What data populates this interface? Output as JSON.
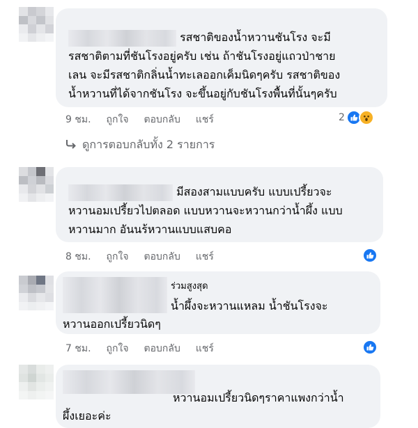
{
  "comments": [
    {
      "text_lines": [
        "รสชาติของน้ำหวานชันโรง จะมี",
        "รสชาติตามที่ชันโรงอยู่ครับ เช่น ถ้าชันโรงอยู่แถวป่าชาย",
        "เลน จะมีรสชาติกลิ่นน้ำทะเลออกเค็มนิดๆครับ รสชาติของ",
        "น้ำหวานที่ได้จากชันโรง จะขึ้นอยู่กับชันโรงพื้นที่นั้นๆครับ"
      ],
      "time": "9 ชม.",
      "like": "ถูกใจ",
      "reply": "ตอบกลับ",
      "share": "แชร์",
      "reaction_count": "2",
      "view_replies": "ดูการตอบกลับทั้ง 2 รายการ"
    },
    {
      "text_lines": [
        "มีสองสามแบบครับ แบบเปรี้ยวจะ",
        "หวานอมเปรี้ยวไปตลอด แบบหวานจะหวานกว่าน้ำผึ้ง แบบ",
        "หวานมาก อันนร้หวานแบบแสบคอ"
      ],
      "time": "8 ชม.",
      "like": "ถูกใจ",
      "reply": "ตอบกลับ",
      "share": "แชร์"
    },
    {
      "badge": "ร่วมสูงสุด",
      "text_lines": [
        "น้ำผึ้งจะหวานแหลม น้ำชันโรงจะ",
        "หวานออกเปรี้ยวนิดๆ"
      ],
      "time": "7 ชม.",
      "like": "ถูกใจ",
      "reply": "ตอบกลับ",
      "share": "แชร์"
    },
    {
      "text_lines": [
        "หวานอมเปรี้ยวนิดๆราคาแพงกว่าน้ำ",
        "ผึ้งเยอะค่ะ"
      ]
    }
  ],
  "colors": {
    "bubble": "#f0f2f5",
    "meta": "#65676b",
    "like_blue": "#1877f2",
    "wow_yellow": "#f7b125"
  },
  "icons": {
    "reactions": [
      "like-icon",
      "wow-icon"
    ],
    "replies": "reply-arrow-icon"
  }
}
